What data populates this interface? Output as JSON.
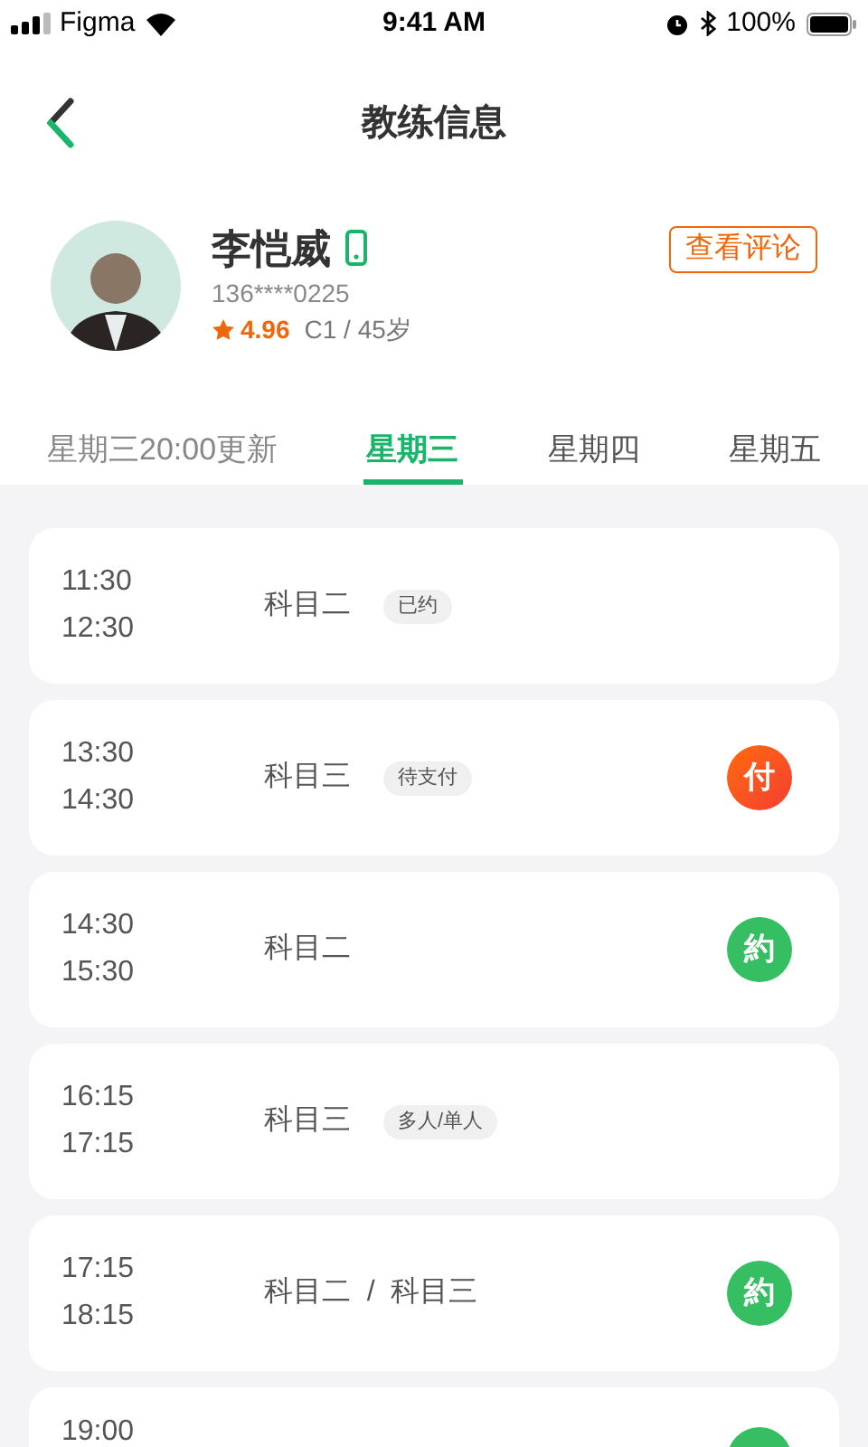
{
  "status_bar": {
    "carrier": "Figma",
    "time": "9:41 AM",
    "battery": "100%"
  },
  "nav": {
    "title": "教练信息"
  },
  "coach": {
    "name": "李恺威",
    "phone": "136****0225",
    "rating": "4.96",
    "details": "C1 / 45岁",
    "review_button": "查看评论"
  },
  "tabs": [
    {
      "label": "星期三20:00更新",
      "selected": false
    },
    {
      "label": "星期三",
      "selected": true
    },
    {
      "label": "星期四",
      "selected": false
    },
    {
      "label": "星期五",
      "selected": false
    }
  ],
  "slots": [
    {
      "start": "11:30",
      "end": "12:30",
      "subject": "科目二",
      "tag": "已约"
    },
    {
      "start": "13:30",
      "end": "14:30",
      "subject": "科目三",
      "tag": "待支付",
      "action": {
        "kind": "pay",
        "label": "付"
      }
    },
    {
      "start": "14:30",
      "end": "15:30",
      "subject": "科目二",
      "action": {
        "kind": "book",
        "label": "約"
      }
    },
    {
      "start": "16:15",
      "end": "17:15",
      "subject": "科目三",
      "tag": "多人/单人"
    },
    {
      "start": "17:15",
      "end": "18:15",
      "subject": "科目二 / 科目三",
      "action": {
        "kind": "book",
        "label": "約"
      }
    },
    {
      "start": "19:00",
      "action": {
        "kind": "book"
      }
    }
  ]
}
